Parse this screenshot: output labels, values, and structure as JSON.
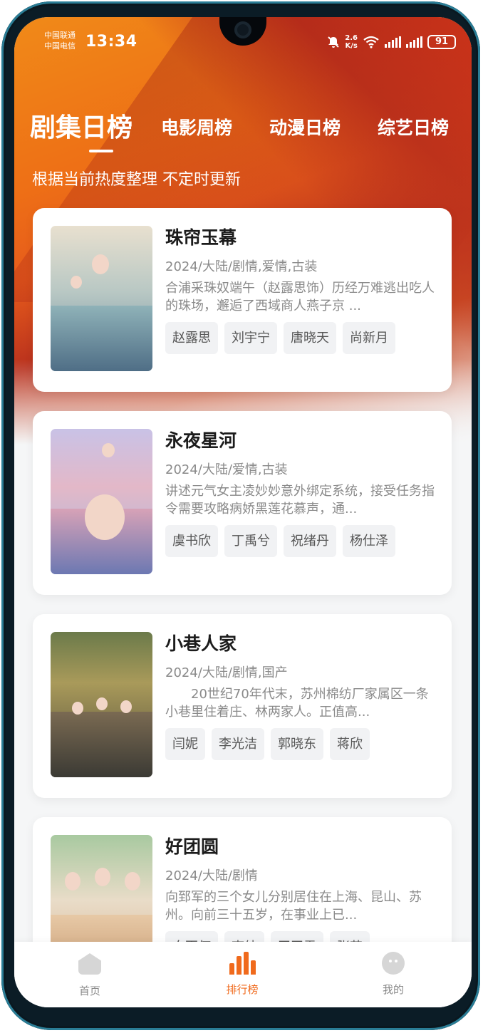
{
  "status_bar": {
    "carrier_1": "中国联通",
    "carrier_2": "中国电信",
    "time": "13:34",
    "net_speed_value": "2.6",
    "net_speed_unit": "K/s",
    "battery": "91"
  },
  "tabs": [
    {
      "label": "剧集日榜",
      "active": true
    },
    {
      "label": "电影周榜",
      "active": false
    },
    {
      "label": "动漫日榜",
      "active": false
    },
    {
      "label": "综艺日榜",
      "active": false
    }
  ],
  "subtitle": "根据当前热度整理 不定时更新",
  "shows": [
    {
      "title": "珠帘玉幕",
      "meta": "2024/大陆/剧情,爱情,古装",
      "description": "合浦采珠奴端午（赵露思饰）历经万难逃出吃人的珠场，邂逅了西域商人燕子京 ...",
      "actors": [
        "赵露思",
        "刘宇宁",
        "唐晓天",
        "尚新月"
      ]
    },
    {
      "title": "永夜星河",
      "meta": "2024/大陆/爱情,古装",
      "description": "讲述元气女主凌妙妙意外绑定系统，接受任务指令需要攻略病娇黑莲花慕声，通...",
      "actors": [
        "虞书欣",
        "丁禹兮",
        "祝绪丹",
        "杨仕泽"
      ]
    },
    {
      "title": "小巷人家",
      "meta": "2024/大陆/剧情,国产",
      "description": "　　20世纪70年代末，苏州棉纺厂家属区一条小巷里住着庄、林两家人。正值高...",
      "actors": [
        "闫妮",
        "李光洁",
        "郭晓东",
        "蒋欣"
      ]
    },
    {
      "title": "好团圆",
      "meta": "2024/大陆/剧情",
      "description": "向郅军的三个女儿分别居住在上海、昆山、苏州。向前三十五岁，在事业上已...",
      "actors": [
        "白百何",
        "李纯",
        "王玉雯",
        "张艺"
      ]
    }
  ],
  "bottom_nav": [
    {
      "label": "首页",
      "icon": "home-icon",
      "active": false
    },
    {
      "label": "排行榜",
      "icon": "ranking-icon",
      "active": true
    },
    {
      "label": "我的",
      "icon": "profile-icon",
      "active": false
    }
  ],
  "colors": {
    "accent": "#f06a1c",
    "hero_orange": "#ee6f16",
    "hero_red": "#b8301d"
  }
}
